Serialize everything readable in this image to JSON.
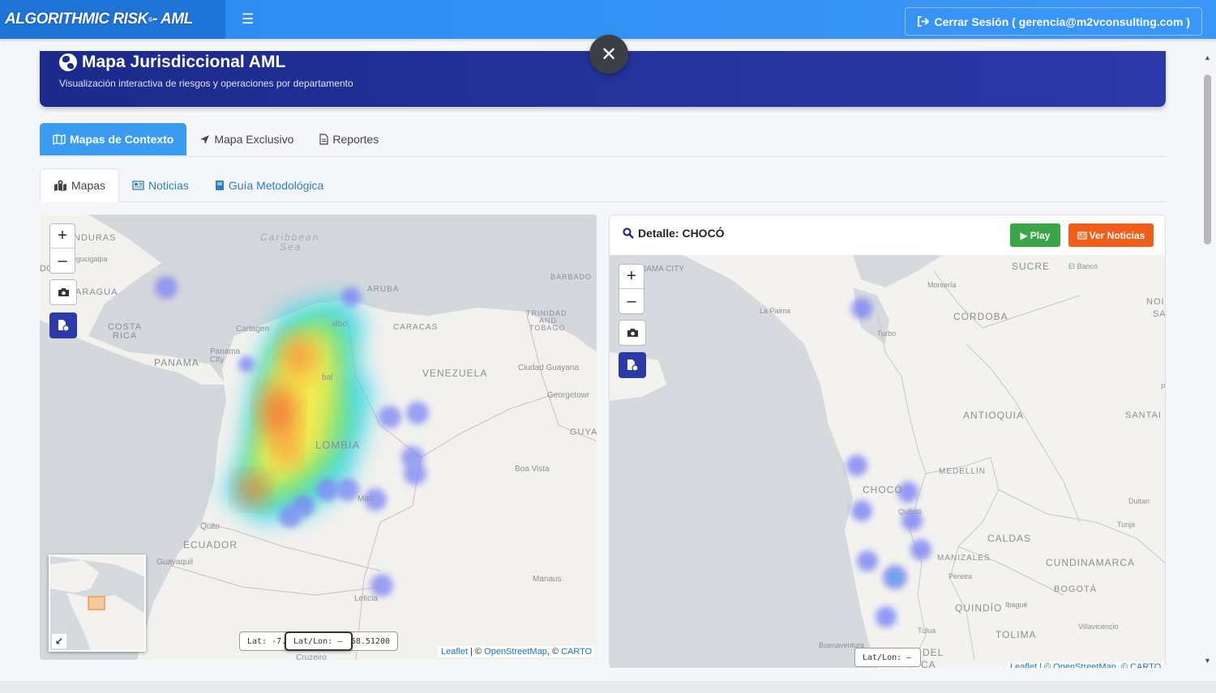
{
  "navbar": {
    "brand": "ALGORITHMIC RISK",
    "brand_reg": "®",
    "brand_suffix": " - AML",
    "menu_icon": "hamburger-icon",
    "logout_label": "Cerrar Sesión ( gerencia@m2vconsulting.com )",
    "logout_icon": "sign-out-icon"
  },
  "banner": {
    "title": "Mapa Jurisdiccional AML",
    "subtitle": "Visualización interactiva de riesgos y operaciones por departamento",
    "icon": "globe-icon"
  },
  "main_tabs": [
    {
      "label": "Mapas de Contexto",
      "icon": "map-icon",
      "active": true
    },
    {
      "label": "Mapa Exclusivo",
      "icon": "location-arrow-icon",
      "active": false
    },
    {
      "label": "Reportes",
      "icon": "file-icon",
      "active": false
    }
  ],
  "sub_tabs": [
    {
      "label": "Mapas",
      "icon": "map-marked-icon",
      "active": true
    },
    {
      "label": "Noticias",
      "icon": "newspaper-icon",
      "active": false
    },
    {
      "label": "Guía Metodológica",
      "icon": "book-icon",
      "active": false
    }
  ],
  "left_map": {
    "labels": {
      "honduras": "NDURAS",
      "tegucigalpa": "egucigalpa",
      "caribbean": "Caribbean",
      "sea": "Sea",
      "nicaragua": "ARAGUA",
      "costa_rica_1": "COSTA",
      "costa_rica_2": "RICA",
      "panama": "PANAMA",
      "panama_city_1": "Panama",
      "panama_city_2": "City",
      "aruba": "ARUBA",
      "barbados": "BARBADO",
      "cartagena": "Cartagen",
      "caracas": "CARACAS",
      "trinidad_1": "TRINIDAD",
      "trinidad_2": "AND",
      "trinidad_3": "TOBAGO",
      "venezuela": "VENEZUELA",
      "ciudad_guayana": "Ciudad Guayana",
      "georgetown": "Georgetowr",
      "guyana": "GUYA",
      "colombia": "LOMBIA",
      "boa_vista": "Boa Vista",
      "mitu": "Mitú",
      "quito": "Quito",
      "ecuador": "ECUADOR",
      "guayaquil": "Guayaquil",
      "manaus": "Manaus",
      "leticia": "Leticia",
      "cruzeiro": "Cruzeiro",
      "dc": "DC",
      "albo": "albo",
      "bal": "bal"
    },
    "coord_lat": "Lat: -7.",
    "coord_latlon": "Lat/Lon: –",
    "coord_tail": "58.51200",
    "attribution_leaflet": "Leaflet",
    "attribution_sep": " | © ",
    "attribution_osm": "OpenStreetMap",
    "attribution_carto_sep": ", © ",
    "attribution_carto": "CARTO"
  },
  "detail": {
    "title": "Detalle: CHOCÓ",
    "play_label": "Play",
    "news_label": "Ver Noticias",
    "labels": {
      "panama_city": "NAMA CITY",
      "sucre": "SUCRE",
      "el_banco": "El Banco",
      "monteria": "Montería",
      "la_palma": "La Palma",
      "cordoba": "CÓRDOBA",
      "norte_1": "NOI",
      "norte_2": "SAN",
      "turbo": "Turbo",
      "antioquia": "ANTIOQUIA",
      "santander": "SANTAI",
      "medellin": "MEDELLÍN",
      "choco": "CHOCÓ",
      "quibdo": "Quibdó",
      "duitama": "Duitan",
      "tunja": "Tunja",
      "caldas": "CALDAS",
      "manizales": "MANIZALES",
      "cundinamarca": "CUNDINAMARCA",
      "pereira": "Pereira",
      "bogota": "BOGOTÁ",
      "quindio": "QUINDÍO",
      "ibague": "Ibagué",
      "tolima": "TOLIMA",
      "tulua": "Tuluá",
      "villavicencio": "Villavicencio",
      "buenaventura": "Buenaventura",
      "del": "DEL",
      "ca": "CA",
      "p": "P"
    },
    "coord_latlon": "Lat/Lon: –",
    "attribution": "Leaflet | © OpenStreetMap, © CARTO"
  }
}
